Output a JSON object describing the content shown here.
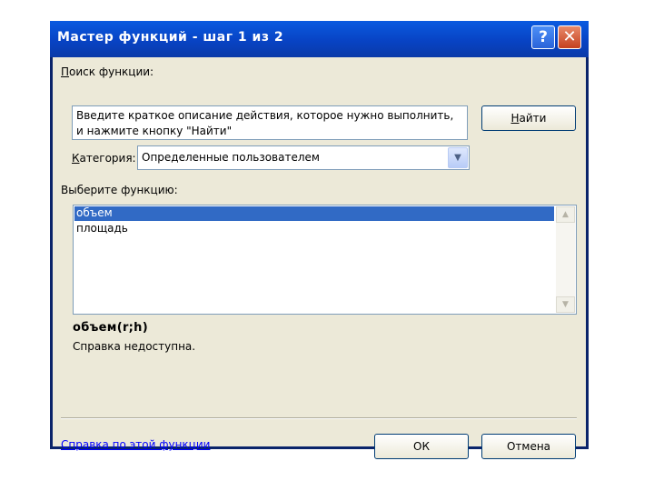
{
  "dialog": {
    "title": "Мастер функций - шаг 1 из 2",
    "help_button": "?",
    "close_button": "✕"
  },
  "search": {
    "label_underlined": "П",
    "label_rest": "оиск функции:",
    "placeholder": "Введите краткое описание действия, которое нужно выполнить, и нажмите кнопку \"Найти\"",
    "find_label_pre": "",
    "find_label_underlined": "Н",
    "find_label_rest": "айти"
  },
  "category": {
    "label_underlined": "К",
    "label_rest": "атегория:",
    "selected": "Определенные пользователем"
  },
  "function_list": {
    "label": "Выберите функцию:",
    "items": [
      "объем",
      "площадь"
    ],
    "selected_index": 0
  },
  "function_info": {
    "signature": "объем(r;h)",
    "description": "Справка недоступна."
  },
  "footer": {
    "help_link": "Справка по этой функции",
    "ok_label": "ОК",
    "cancel_label": "Отмена"
  }
}
